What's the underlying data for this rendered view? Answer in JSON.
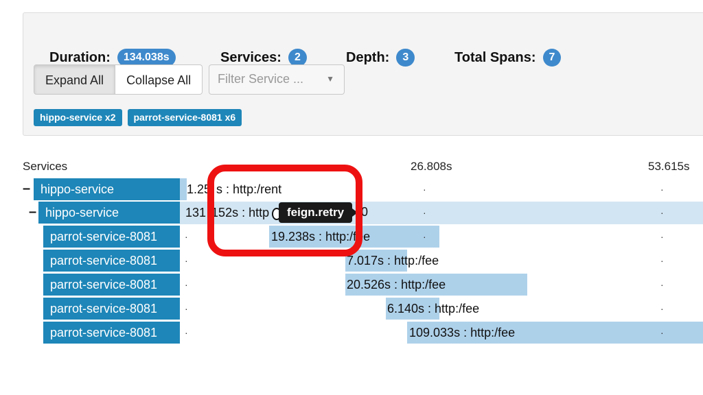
{
  "summary": {
    "duration_label": "Duration:",
    "duration_value": "134.038s",
    "services_label": "Services:",
    "services_value": "2",
    "depth_label": "Depth:",
    "depth_value": "3",
    "spans_label": "Total Spans:",
    "spans_value": "7"
  },
  "controls": {
    "expand_all": "Expand All",
    "collapse_all": "Collapse All",
    "filter_placeholder": "Filter Service ...",
    "filter_caret": "▼"
  },
  "tags": [
    "hippo-service x2",
    "parrot-service-8081 x6"
  ],
  "header": {
    "services": "Services",
    "tick_1": "26.808s",
    "tick_2": "53.615s"
  },
  "rows": [
    {
      "toggle": "–",
      "service": "hippo-service",
      "label": "1.25",
      "label_tail": "s : http:/rent",
      "bar_start": 0.0,
      "bar_fraction": 0.009
    },
    {
      "toggle": "–",
      "service": "hippo-service",
      "label": "131",
      "label_tail": "152s : http",
      "bar_start": 0.0,
      "bar_fraction": 0.98
    },
    {
      "toggle": "",
      "service": "parrot-service-8081",
      "label": "19.238s : http:/fee",
      "bar_start": 0.0953,
      "bar_fraction": 0.1435
    },
    {
      "toggle": "",
      "service": "parrot-service-8081",
      "label": "7.017s : http:/fee",
      "bar_start": 0.2235,
      "bar_fraction": 0.0523
    },
    {
      "toggle": "",
      "service": "parrot-service-8081",
      "label": "20.526s : http:/fee",
      "bar_start": 0.2235,
      "bar_fraction": 0.1531
    },
    {
      "toggle": "",
      "service": "parrot-service-8081",
      "label": "6.140s : http:/fee",
      "bar_start": 0.2944,
      "bar_fraction": 0.0458
    },
    {
      "toggle": "",
      "service": "parrot-service-8081",
      "label": "109.033s : http:/fee",
      "bar_start": 0.3309,
      "bar_fraction": 0.8134
    }
  ],
  "tooltip": {
    "text": "feign.retry",
    "trailing": "0"
  },
  "colors": {
    "badge": "#3e89cc",
    "service": "#1e86b8",
    "span_bar": "#aed1ea",
    "highlight_row": "#d2e5f2",
    "annotation": "#ee1111"
  }
}
